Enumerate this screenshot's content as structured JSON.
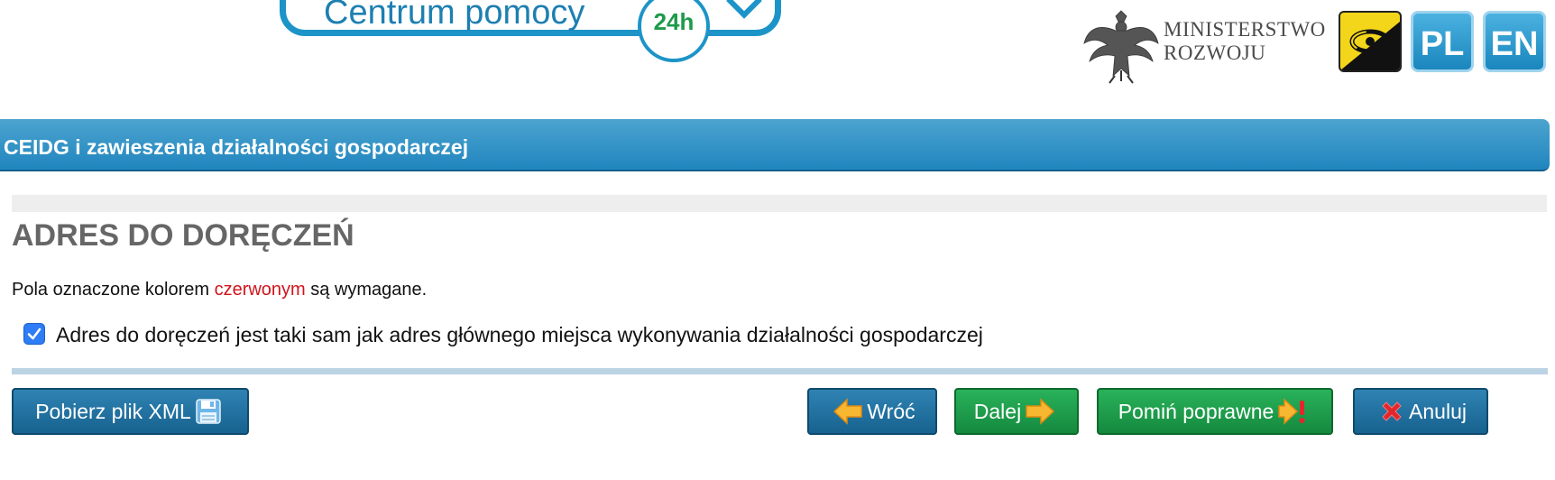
{
  "header": {
    "help_label": "Centrum pomocy",
    "help_badge": "24h",
    "ministry_line1": "MINISTERSTWO",
    "ministry_line2": "ROZWOJU",
    "lang_pl": "PL",
    "lang_en": "EN"
  },
  "titlebar": {
    "title": "CEIDG i zawieszenia działalności gospodarczej"
  },
  "section": {
    "heading": "ADRES DO DORĘCZEŃ",
    "required_prefix": "Pola oznaczone kolorem ",
    "required_red": "czerwonym",
    "required_suffix": " są wymagane."
  },
  "form": {
    "same_address_checkbox": {
      "checked": true,
      "label": "Adres do doręczeń jest taki sam jak adres głównego miejsca wykonywania działalności gospodarczej"
    }
  },
  "buttons": {
    "xml": "Pobierz plik XML",
    "back": "Wróć",
    "next": "Dalej",
    "skip_valid": "Pomiń poprawne",
    "cancel": "Anuluj"
  },
  "colors": {
    "primary_blue": "#2085be",
    "button_blue": "#17628f",
    "button_green": "#15893f",
    "required_red": "#d0141c",
    "accessibility_yellow": "#f3d51a"
  },
  "icons": {
    "help_chevron": "chevron-down-icon",
    "ministry": "eagle-emblem-icon",
    "accessibility": "eye-icon",
    "xml": "floppy-disk-icon",
    "back": "arrow-left-icon",
    "next": "arrow-right-icon",
    "skip": "arrow-right-exclamation-icon",
    "cancel": "red-x-icon"
  }
}
